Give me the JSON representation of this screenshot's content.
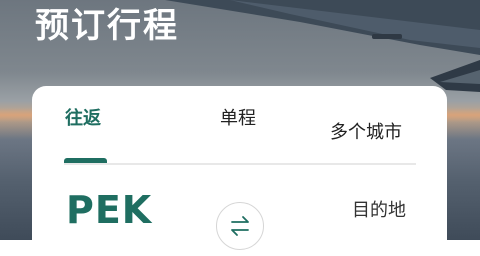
{
  "header": {
    "title": "预订行程"
  },
  "trip_type_tabs": [
    {
      "label": "往返",
      "selected": true
    },
    {
      "label": "单程",
      "selected": false
    },
    {
      "label": "多个城市",
      "selected": false
    }
  ],
  "route": {
    "origin_code": "PEK",
    "destination_placeholder": "目的地"
  },
  "colors": {
    "accent": "#1f6e61",
    "card_background": "#ffffff",
    "title_text": "#ffffff"
  },
  "icons": {
    "swap": "swap-arrows-icon"
  }
}
